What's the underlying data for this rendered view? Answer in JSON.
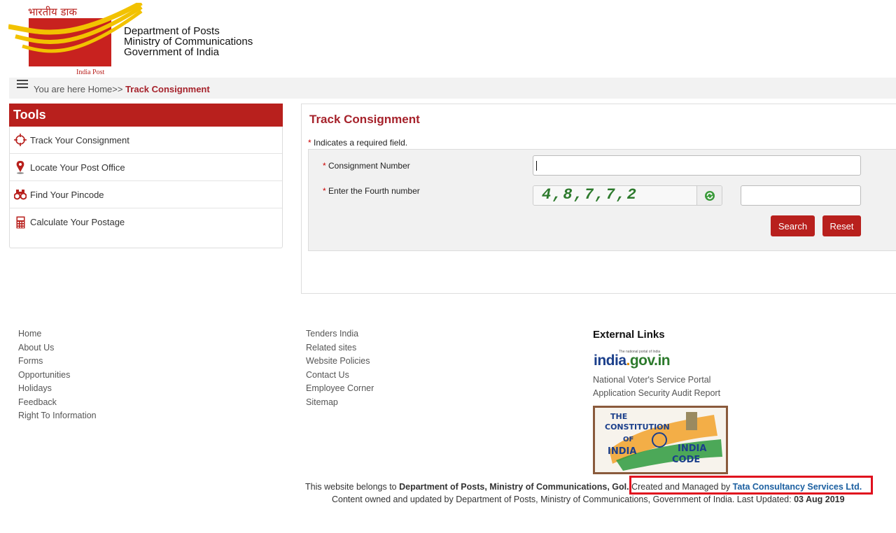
{
  "header": {
    "logo_hindi": "भारतीय डाक",
    "logo_caption": "India Post",
    "org_line1": "Department of Posts",
    "org_line2": "Ministry of Communications",
    "org_line3": "Government of India"
  },
  "breadcrumb": {
    "prefix": "You are here Home>> ",
    "current": "Track Consignment"
  },
  "tools": {
    "title": "Tools",
    "items": [
      {
        "label": "Track Your Consignment",
        "icon": "crosshair-icon"
      },
      {
        "label": "Locate Your Post Office",
        "icon": "map-pin-icon"
      },
      {
        "label": "Find Your Pincode",
        "icon": "binoculars-icon"
      },
      {
        "label": "Calculate Your Postage",
        "icon": "calculator-icon"
      }
    ]
  },
  "form": {
    "title": "Track Consignment",
    "required_note": "Indicates a required field.",
    "required_star": "*",
    "consignment_label": "Consignment Number",
    "consignment_value": "",
    "fourth_label": "Enter the Fourth number",
    "captcha_text": "4,8,7,7,2",
    "fourth_value": "",
    "search_label": "Search",
    "reset_label": "Reset"
  },
  "footer": {
    "col1": [
      "Home",
      "About Us",
      "Forms",
      "Opportunities",
      "Holidays",
      "Feedback",
      "Right To Information"
    ],
    "col2": [
      "Tenders India",
      "Related sites",
      "Website Policies",
      "Contact Us",
      "Employee Corner",
      "Sitemap"
    ],
    "external_title": "External Links",
    "indiagov_tagline": "The national portal of India",
    "indiagov_a": "india",
    "indiagov_b": ".",
    "indiagov_c": "gov.in",
    "ext_links": [
      "National Voter's Service Portal",
      "Application Security Audit Report"
    ],
    "constitution_line1": "THE",
    "constitution_line2": "CONSTITUTION",
    "constitution_line3": "OF",
    "constitution_line4": "INDIA",
    "constitution_line5": "INDIA",
    "constitution_line6": "CODE",
    "belongs_prefix": "This website belongs to ",
    "belongs_bold": "Department of Posts, Ministry of Communications, GoI.",
    "created_prefix": "Created and Managed by ",
    "created_link": "Tata Consultancy Services Ltd.",
    "content_owned": "Content owned and updated by Department of Posts, Ministry of Communications, Government of India. Last Updated: ",
    "last_updated": "03 Aug 2019"
  },
  "colors": {
    "brand_red": "#b8201d",
    "title_red": "#a6222b",
    "highlight_red": "#e0101e",
    "link_blue": "#1b5fa0"
  }
}
